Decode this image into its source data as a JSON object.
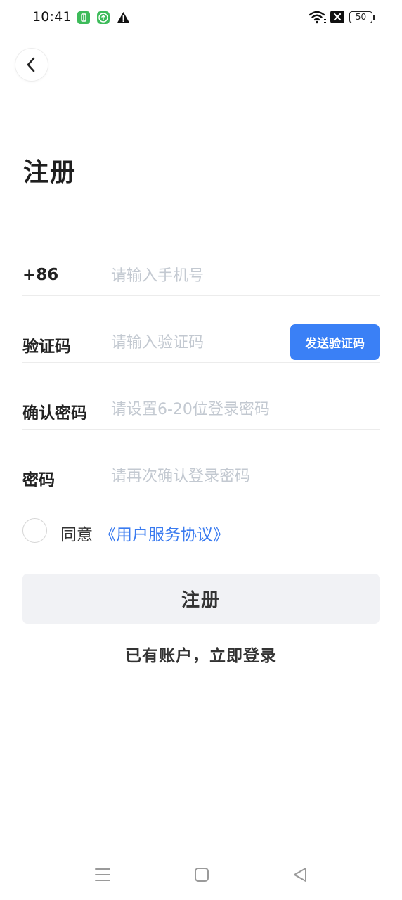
{
  "status_bar": {
    "time": "10:41",
    "battery": "50",
    "icons": [
      "app-notification-icon",
      "upload-notification-icon",
      "warning-icon",
      "wifi-icon",
      "x-badge-icon",
      "battery-icon"
    ]
  },
  "header": {
    "back_icon": "chevron-left-icon"
  },
  "page": {
    "title": "注册"
  },
  "form": {
    "phone": {
      "label": "+86",
      "placeholder": "请输入手机号",
      "value": ""
    },
    "code": {
      "label": "验证码",
      "placeholder": "请输入验证码",
      "value": "",
      "send_button": "发送验证码"
    },
    "confirm_password": {
      "label": "确认密码",
      "placeholder": "请设置6-20位登录密码",
      "value": ""
    },
    "password": {
      "label": "密码",
      "placeholder": "请再次确认登录密码",
      "value": ""
    }
  },
  "agreement": {
    "checked": false,
    "prefix": "同意",
    "link": "《用户服务协议》"
  },
  "actions": {
    "register": "注册",
    "login_link": "已有账户，立即登录"
  },
  "nav_bar": {
    "icons": [
      "menu-icon",
      "home-icon",
      "back-triangle-icon"
    ]
  },
  "colors": {
    "accent": "#3a80f6",
    "link": "#3a7bf0",
    "placeholder": "#c3c9d1",
    "register_bg": "#f1f2f5"
  }
}
